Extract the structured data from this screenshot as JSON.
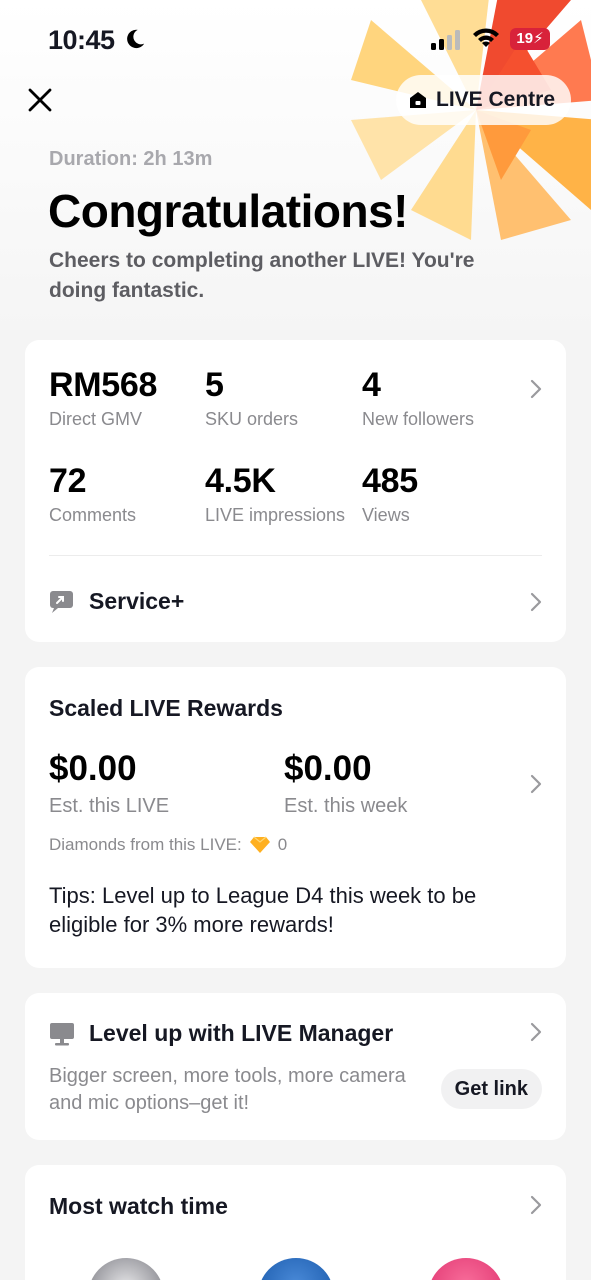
{
  "status_bar": {
    "time": "10:45",
    "battery": "19"
  },
  "header": {
    "live_centre_label": "LIVE Centre"
  },
  "hero": {
    "duration": "Duration: 2h 13m",
    "title": "Congratulations!",
    "subtitle": "Cheers to completing another LIVE! You're doing fantastic."
  },
  "stats": {
    "items": [
      {
        "value": "RM568",
        "label": "Direct GMV"
      },
      {
        "value": "5",
        "label": "SKU orders"
      },
      {
        "value": "4",
        "label": "New followers"
      },
      {
        "value": "72",
        "label": "Comments"
      },
      {
        "value": "4.5K",
        "label": "LIVE impressions"
      },
      {
        "value": "485",
        "label": "Views"
      }
    ],
    "service_label": "Service+"
  },
  "rewards": {
    "title": "Scaled LIVE Rewards",
    "this_live_value": "$0.00",
    "this_live_label": "Est. this LIVE",
    "this_week_value": "$0.00",
    "this_week_label": "Est. this week",
    "diamonds_label": "Diamonds from this LIVE:",
    "diamonds_value": "0",
    "tips": "Tips: Level up to League D4 this week to be eligible for 3% more rewards!"
  },
  "manager": {
    "title": "Level up with LIVE Manager",
    "description": "Bigger screen, more tools, more camera and mic options–get it!",
    "button_label": "Get link"
  },
  "watch_time": {
    "title": "Most watch time"
  },
  "colors": {
    "battery": "#d8223a",
    "starburst_red": "#f04a2f",
    "starburst_orange": "#ffb347"
  }
}
